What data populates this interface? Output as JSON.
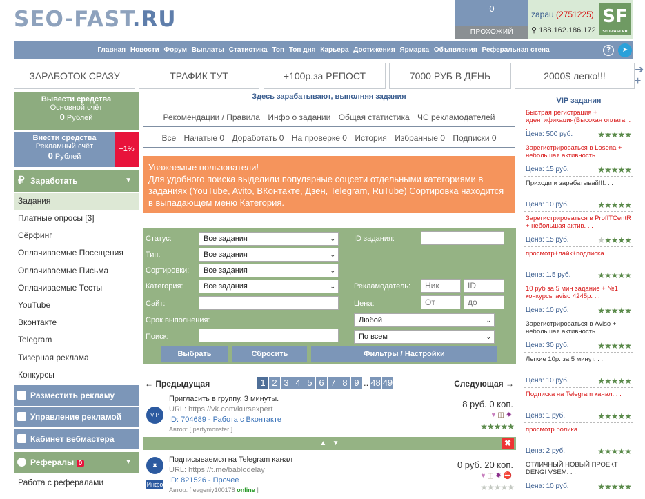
{
  "header": {
    "logo_main": "SEO-FAST",
    "logo_ru": ".RU",
    "visitors_count": "0",
    "visitors_label": "ПРОХОЖИЙ",
    "user_name": "zapau",
    "user_id": "(2751225)",
    "ip": "188.162.186.172",
    "sf_logo": "SF",
    "sf_small": "SEO-FAST.RU"
  },
  "nav": [
    "Главная",
    "Новости",
    "Форум",
    "Выплаты",
    "Статистика",
    "Топ",
    "Топ дня",
    "Карьера",
    "Достижения",
    "Ярмарка",
    "Объявления",
    "Реферальная стена"
  ],
  "banners": [
    "ЗАРАБОТОК СРАЗУ",
    "ТРАФИК ТУТ",
    "+100р.за РЕПОСТ",
    "7000 РУБ В ДЕНЬ",
    "2000$ легко!!!"
  ],
  "left": {
    "withdraw_title": "Вывести средства",
    "withdraw_sub": "Основной счёт",
    "withdraw_sum": "0",
    "withdraw_cur": "Рублей",
    "deposit_title": "Внести средства",
    "deposit_sub": "Рекламный счёт",
    "deposit_sum": "0",
    "deposit_cur": "Рублей",
    "pct": "+1%",
    "earn": "Заработать",
    "menu": [
      "Задания",
      "Платные опросы [3]",
      "Сёрфинг",
      "Оплачиваемые Посещения",
      "Оплачиваемые Письма",
      "Оплачиваемые Тесты",
      "YouTube",
      "Вконтакте",
      "Telegram",
      "Тизерная реклама",
      "Конкурсы"
    ],
    "btn_place": "Разместить рекламу",
    "btn_manage": "Управление рекламой",
    "btn_webmaster": "Кабинет вебмастера",
    "btn_refs": "Рефералы",
    "refs_count": "0",
    "refs_work": "Работа с рефералами"
  },
  "center": {
    "title": "Здесь зарабатывают, выполняя задания",
    "subnav": [
      "Рекомендации / Правила",
      "Инфо о задании",
      "Общая статистика",
      "ЧС рекламодателей"
    ],
    "tabs": [
      "Все",
      "Начатые 0",
      "Доработать 0",
      "На проверке 0",
      "История",
      "Избранные 0",
      "Подписки 0"
    ],
    "notice_line1": "Уважаемые пользователи!",
    "notice_line2": "Для удобного поиска выделили популярные соцсети отдельными категориями в заданиях (YouTube, Avito, ВКонтакте, Дзен, Telegram, RuTube) Сортировка находится в выпадающем меню Категория.",
    "filters": {
      "status_label": "Статус:",
      "status_val": "Все задания",
      "type_label": "Тип:",
      "type_val": "Все задания",
      "sort_label": "Сортировки:",
      "sort_val": "Все задания",
      "cat_label": "Категория:",
      "cat_val": "Все задания",
      "site_label": "Сайт:",
      "term_label": "Срок выполнения:",
      "search_label": "Поиск:",
      "id_label": "ID задания:",
      "adv_label": "Рекламодатель:",
      "adv_nick": "Ник",
      "adv_id": "ID",
      "price_label": "Цена:",
      "price_from": "От",
      "price_to": "до",
      "term_val": "Любой",
      "search_val": "По всем",
      "btn_choose": "Выбрать",
      "btn_reset": "Сбросить",
      "btn_filters": "Фильтры / Настройки"
    },
    "pager": {
      "prev": "← Предыдущая",
      "next": "Следующая →",
      "pages": [
        "1",
        "2",
        "3",
        "4",
        "5",
        "6",
        "7",
        "8",
        "9",
        "..",
        "48",
        "49"
      ]
    },
    "tasks": [
      {
        "title": "Пригласить в группу. 3 минуты.",
        "url": "URL: https://vk.com/kursexpert",
        "id": "ID: 704689 - Работа с Вконтакте",
        "author": "Автор: [ partymonster ]",
        "price": "8 руб. 0 коп.",
        "icon": "VIP"
      },
      {
        "title": "Подписываемся на Telegram канал",
        "url": "URL: https://t.me/bablodelay",
        "id": "ID: 821526 - Прочее",
        "author": "Автор: [ evgeniy100178",
        "online": "online",
        "price": "0 руб. 20 коп.",
        "icon": "Инфо"
      }
    ]
  },
  "vip": {
    "title": "VIP задания",
    "items": [
      {
        "text": "Быстрая регистрация + идентификация(Высокая оплата. . .",
        "price": "Цена: 500 руб.",
        "red": true,
        "stars": 5
      },
      {
        "text": "Зарегистрироваться в Losena + небольшая активность. . .",
        "price": "Цена: 15 руб.",
        "red": true,
        "stars": 5
      },
      {
        "text": "Приходи и зарабатывай!!!. . .",
        "price": "Цена: 10 руб.",
        "red": false,
        "stars": 5
      },
      {
        "text": "Зарегистрироваться в ProfITCentR + небольшая актив. . .",
        "price": "Цена: 15 руб.",
        "red": true,
        "stars": 4
      },
      {
        "text": "просмотр+лайк+подписка. . .",
        "price": "Цена: 1.5 руб.",
        "red": true,
        "stars": 5
      },
      {
        "text": "10 руб за 5 мин задание + №1 конкурсы aviso 4245р. . .",
        "price": "Цена: 10 руб.",
        "red": true,
        "stars": 5
      },
      {
        "text": "Зарегистрироваться в Aviso + небольшая активность. . .",
        "price": "Цена: 30 руб.",
        "red": false,
        "stars": 5
      },
      {
        "text": "Легкие 10р. за 5 минут. . .",
        "price": "Цена: 10 руб.",
        "red": false,
        "stars": 5
      },
      {
        "text": "Подписка на Telegram канал. . .",
        "price": "Цена: 1 руб.",
        "red": true,
        "stars": 5
      },
      {
        "text": "просмотр ролика. . .",
        "price": "Цена: 2 руб.",
        "red": true,
        "stars": 5
      },
      {
        "text": "ОТЛИЧНЫЙ НОВЫЙ ПРОЕКТ DENGI VSEM. . .",
        "price": "Цена: 10 руб.",
        "red": false,
        "stars": 5
      }
    ]
  }
}
